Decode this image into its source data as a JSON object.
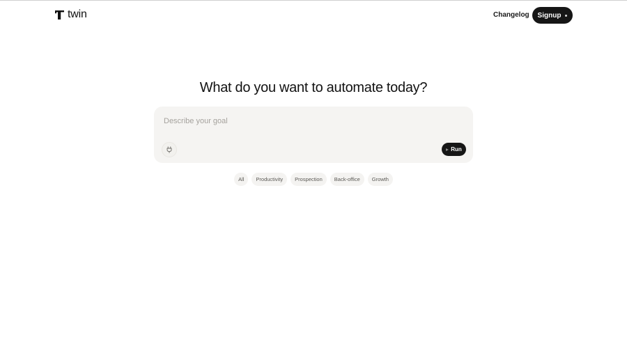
{
  "header": {
    "brand": "twin",
    "changelog_label": "Changelog",
    "signup_label": "Signup"
  },
  "main": {
    "headline": "What do you want to automate today?",
    "goal_placeholder": "Describe your goal",
    "goal_value": "",
    "run_label": "Run",
    "filters": [
      "All",
      "Productivity",
      "Prospection",
      "Back-office",
      "Growth"
    ]
  },
  "icons": {
    "brand_mark": "t-logo-icon",
    "integrations": "plug-icon",
    "run": "play-icon",
    "signup_indicator": "dot-icon"
  },
  "colors": {
    "primary_dark": "#161616",
    "composer_bg": "#f5f4f2",
    "chip_bg": "#f4f3f1",
    "placeholder": "#a5a29d"
  }
}
